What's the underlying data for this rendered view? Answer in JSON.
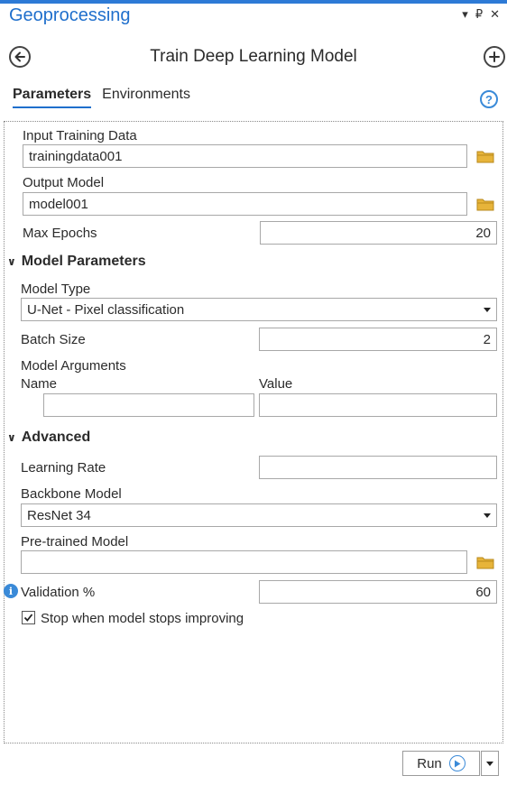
{
  "pane": {
    "title": "Geoprocessing",
    "menu_glyph": "▾",
    "pin_glyph": "₽",
    "close_glyph": "✕"
  },
  "tool": {
    "title": "Train Deep Learning Model"
  },
  "tabs": [
    {
      "label": "Parameters",
      "active": true
    },
    {
      "label": "Environments",
      "active": false
    }
  ],
  "help_label": "?",
  "params": {
    "input_training_data": {
      "label": "Input Training Data",
      "value": "trainingdata001"
    },
    "output_model": {
      "label": "Output Model",
      "value": "model001"
    },
    "max_epochs": {
      "label": "Max Epochs",
      "value": "20"
    }
  },
  "model_parameters": {
    "section_label": "Model Parameters",
    "model_type": {
      "label": "Model Type",
      "value": "U-Net - Pixel classification"
    },
    "batch_size": {
      "label": "Batch Size",
      "value": "2"
    },
    "model_arguments": {
      "label": "Model Arguments",
      "name_header": "Name",
      "value_header": "Value",
      "name_value": "",
      "value_value": ""
    }
  },
  "advanced": {
    "section_label": "Advanced",
    "learning_rate": {
      "label": "Learning Rate",
      "value": ""
    },
    "backbone_model": {
      "label": "Backbone Model",
      "value": "ResNet 34"
    },
    "pretrained_model": {
      "label": "Pre-trained Model",
      "value": ""
    },
    "validation": {
      "label": "Validation %",
      "value": "60"
    },
    "stop_when_improving": {
      "label": "Stop when model stops improving",
      "checked": true
    }
  },
  "footer": {
    "run_label": "Run"
  },
  "colors": {
    "accent": "#1f6fcc",
    "help": "#3a8ad8",
    "folder": "#e7b43a"
  }
}
